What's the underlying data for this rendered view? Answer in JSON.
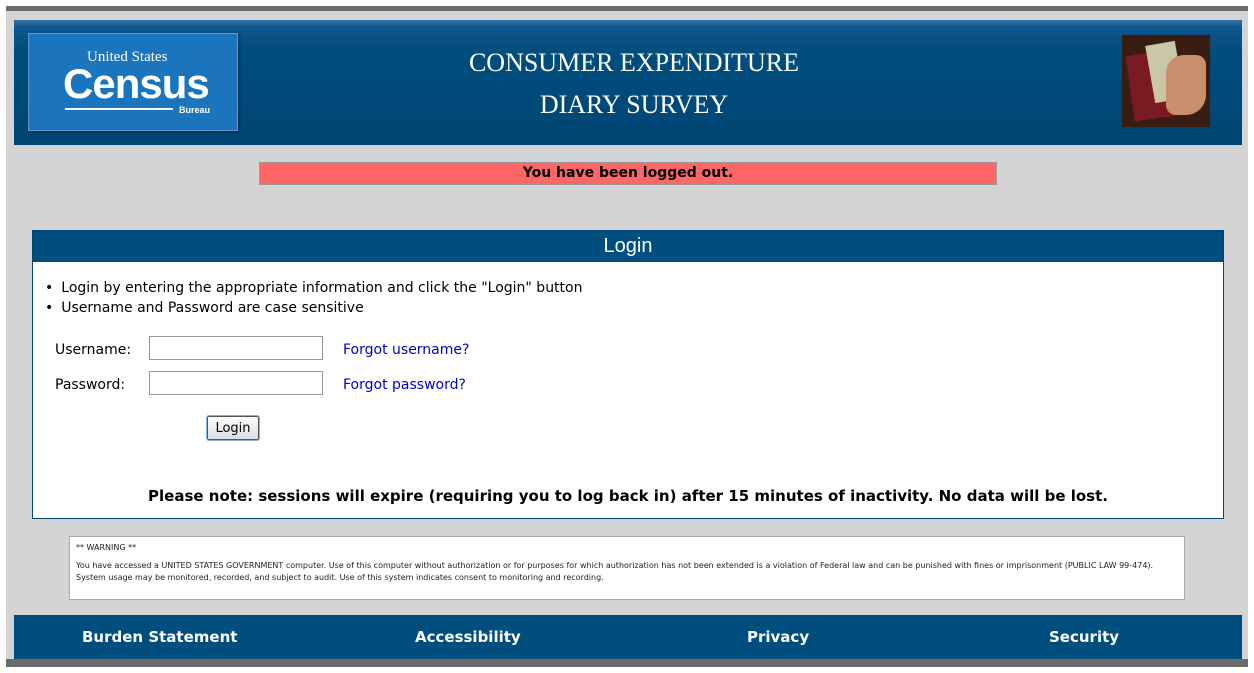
{
  "header": {
    "logo": {
      "line1": "United States",
      "line2": "Census",
      "line3": "Bureau"
    },
    "title_line1": "CONSUMER EXPENDITURE",
    "title_line2": "DIARY SURVEY"
  },
  "alert": {
    "message": "You have been logged out.",
    "color": "#ff6666"
  },
  "login": {
    "heading": "Login",
    "instructions": [
      "Login by entering the appropriate information and click the \"Login\" button",
      "Username and Password are case sensitive"
    ],
    "username_label": "Username:",
    "username_value": "",
    "password_label": "Password:",
    "password_value": "",
    "forgot_username": "Forgot username?",
    "forgot_password": "Forgot password?",
    "button_label": "Login",
    "note": "Please note: sessions will expire (requiring you to log back in) after 15 minutes of inactivity. No data will be lost."
  },
  "warning": {
    "title": "** WARNING **",
    "body": "You have accessed a UNITED STATES GOVERNMENT computer. Use of this computer without authorization or for purposes for which authorization has not been extended is a violation of Federal law and can be punished with fines or imprisonment (PUBLIC LAW 99-474). System usage may be monitored, recorded, and subject to audit. Use of this system indicates consent to monitoring and recording."
  },
  "footer": {
    "links": [
      "Burden Statement",
      "Accessibility",
      "Privacy",
      "Security"
    ]
  },
  "colors": {
    "header_bg": "#004e7e",
    "page_bg": "#d4d4d4",
    "link": "#0000cc"
  }
}
